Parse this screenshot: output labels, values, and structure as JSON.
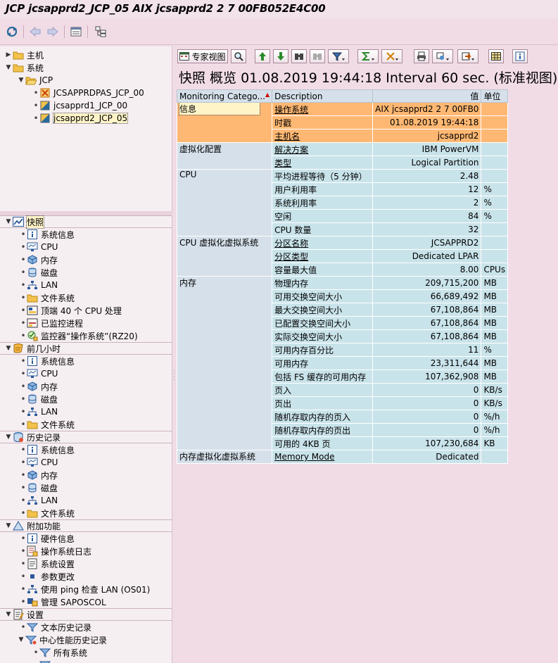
{
  "window": {
    "title": "JCP jcsapprd2_JCP_05 AIX jcsapprd2 2 7 00FB052E4C00"
  },
  "colors": {
    "orange": "#ffb873",
    "blue": "#c9e3ea",
    "category": "#d5e0ea",
    "background": "#f1dce6"
  },
  "tree_top": {
    "items": [
      {
        "label": "主机",
        "icon": "folder-icon"
      },
      {
        "label": "系统",
        "icon": "folder-icon"
      },
      {
        "label": "JCP",
        "icon": "folder-open-icon"
      },
      {
        "label": "JCSAPPRDPAS_JCP_00",
        "icon": "system-error-icon"
      },
      {
        "label": "jcsapprd1_JCP_00",
        "icon": "system-icon"
      },
      {
        "label": "jcsapprd2_JCP_05",
        "icon": "system-icon"
      }
    ]
  },
  "tree_bottom": {
    "groups": [
      {
        "label": "快照",
        "icon": "chart-icon",
        "children": [
          "系统信息",
          "CPU",
          "内存",
          "磁盘",
          "LAN",
          "文件系统",
          "顶端 40 个 CPU 处理",
          "已监控进程",
          "监控器“操作系统”(RZ20)"
        ]
      },
      {
        "label": "前几小时",
        "icon": "history-icon",
        "children": [
          "系统信息",
          "CPU",
          "内存",
          "磁盘",
          "LAN",
          "文件系统"
        ]
      },
      {
        "label": "历史记录",
        "icon": "database-icon",
        "children": [
          "系统信息",
          "CPU",
          "内存",
          "磁盘",
          "LAN",
          "文件系统"
        ]
      },
      {
        "label": "附加功能",
        "icon": "triangle-icon",
        "children": [
          "硬件信息",
          "操作系统日志",
          "系统设置",
          "参数更改",
          "使用 ping 检查 LAN (OS01)",
          "管理 SAPOSCOL"
        ]
      },
      {
        "label": "设置",
        "icon": "settings-icon",
        "children": [
          "文本历史记录",
          "中心性能历史记录"
        ]
      },
      {
        "label": "",
        "icon": "",
        "children": [
          "所有系统",
          "..."
        ]
      }
    ]
  },
  "toolbar_right": {
    "expert_view_label": "专家视图"
  },
  "heading": {
    "text": "快照 概览 01.08.2019 19:44:18 Interval 60 sec. (标准视图)"
  },
  "table": {
    "columns": [
      "Monitoring Catego...",
      "Description",
      "值",
      "单位"
    ],
    "groups": [
      {
        "category": "信息",
        "color": "orange",
        "rows": [
          {
            "desc": "操作系统",
            "value": "AIX jcsapprd2 2 7 00FB0",
            "unit": "",
            "link": true
          },
          {
            "desc": "时戳",
            "value": "01.08.2019 19:44:18",
            "unit": "",
            "link": false
          },
          {
            "desc": "主机名",
            "value": "jcsapprd2",
            "unit": "",
            "link": true
          }
        ]
      },
      {
        "category": "虚拟化配置",
        "color": "blue",
        "rows": [
          {
            "desc": "解决方案",
            "value": "IBM PowerVM",
            "unit": "",
            "link": true
          },
          {
            "desc": "类型",
            "value": "Logical Partition",
            "unit": "",
            "link": true
          }
        ]
      },
      {
        "category": "CPU",
        "color": "blue",
        "rows": [
          {
            "desc": "平均进程等待（5 分钟）",
            "value": "2.48",
            "unit": "",
            "link": false
          },
          {
            "desc": "用户利用率",
            "value": "12",
            "unit": "%",
            "link": false
          },
          {
            "desc": "系统利用率",
            "value": "2",
            "unit": "%",
            "link": false
          },
          {
            "desc": "空闲",
            "value": "84",
            "unit": "%",
            "link": false
          },
          {
            "desc": "CPU 数量",
            "value": "32",
            "unit": "",
            "link": false
          }
        ]
      },
      {
        "category": "CPU 虚拟化虚拟系统",
        "color": "blue",
        "rows": [
          {
            "desc": "分区名称",
            "value": "JCSAPPRD2",
            "unit": "",
            "link": true
          },
          {
            "desc": "分区类型",
            "value": "Dedicated LPAR",
            "unit": "",
            "link": true
          },
          {
            "desc": "容量最大值",
            "value": "8.00",
            "unit": "CPUs",
            "link": false
          }
        ]
      },
      {
        "category": "内存",
        "color": "blue",
        "rows": [
          {
            "desc": "物理内存",
            "value": "209,715,200",
            "unit": "MB",
            "link": false
          },
          {
            "desc": "可用交换空间大小",
            "value": "66,689,492",
            "unit": "MB",
            "link": false
          },
          {
            "desc": "最大交换空间大小",
            "value": "67,108,864",
            "unit": "MB",
            "link": false
          },
          {
            "desc": "已配置交换空间大小",
            "value": "67,108,864",
            "unit": "MB",
            "link": false
          },
          {
            "desc": "实际交换空间大小",
            "value": "67,108,864",
            "unit": "MB",
            "link": false
          },
          {
            "desc": "可用内存百分比",
            "value": "11",
            "unit": "%",
            "link": false
          },
          {
            "desc": "可用内存",
            "value": "23,311,644",
            "unit": "MB",
            "link": false
          },
          {
            "desc": "包括 FS 缓存的可用内存",
            "value": "107,362,908",
            "unit": "MB",
            "link": false
          },
          {
            "desc": "页入",
            "value": "0",
            "unit": "KB/s",
            "link": false
          },
          {
            "desc": "页出",
            "value": "0",
            "unit": "KB/s",
            "link": false
          },
          {
            "desc": "随机存取内存的页入",
            "value": "0",
            "unit": "%/h",
            "link": false
          },
          {
            "desc": "随机存取内存的页出",
            "value": "0",
            "unit": "%/h",
            "link": false
          },
          {
            "desc": "可用的 4KB 页",
            "value": "107,230,684",
            "unit": "KB",
            "link": false
          }
        ]
      },
      {
        "category": "内存虚拟化虚拟系统",
        "color": "blue",
        "rows": [
          {
            "desc": "Memory Mode",
            "value": "Dedicated",
            "unit": "",
            "link": true
          }
        ]
      }
    ]
  }
}
